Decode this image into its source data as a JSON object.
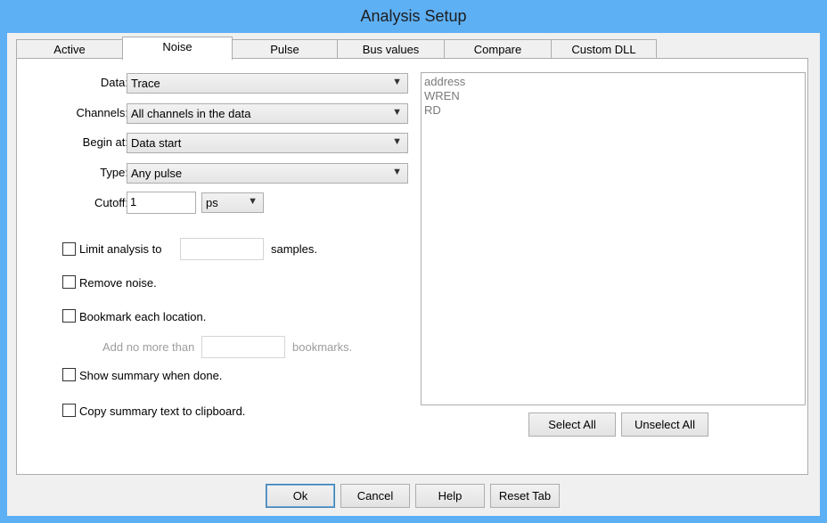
{
  "window": {
    "title": "Analysis Setup"
  },
  "tabs": [
    {
      "label": "Active"
    },
    {
      "label": "Noise"
    },
    {
      "label": "Pulse"
    },
    {
      "label": "Bus values"
    },
    {
      "label": "Compare"
    },
    {
      "label": "Custom DLL"
    }
  ],
  "active_tab": "Noise",
  "form": {
    "data": {
      "label": "Data:",
      "value": "Trace"
    },
    "channels": {
      "label": "Channels:",
      "value": "All channels in the data"
    },
    "begin": {
      "label": "Begin at:",
      "value": "Data start"
    },
    "type": {
      "label": "Type:",
      "value": "Any pulse"
    },
    "cutoff": {
      "label": "Cutoff:",
      "value": "1",
      "unit": "ps"
    }
  },
  "options": {
    "limit": {
      "label": "Limit analysis to",
      "suffix": "samples.",
      "value": "",
      "checked": false
    },
    "remove_noise": {
      "label": "Remove noise.",
      "checked": false
    },
    "bookmark": {
      "label": "Bookmark each location.",
      "checked": false
    },
    "bookmark_limit": {
      "prefix": "Add no more than",
      "suffix": "bookmarks.",
      "value": ""
    },
    "summary": {
      "label": "Show summary when done.",
      "checked": false
    },
    "clipboard": {
      "label": "Copy summary text to clipboard.",
      "checked": false
    }
  },
  "channel_list": [
    "address",
    "WREN",
    "RD"
  ],
  "list_buttons": {
    "select_all": "Select All",
    "unselect_all": "Unselect All"
  },
  "footer": {
    "ok": "Ok",
    "cancel": "Cancel",
    "help": "Help",
    "reset": "Reset Tab"
  }
}
